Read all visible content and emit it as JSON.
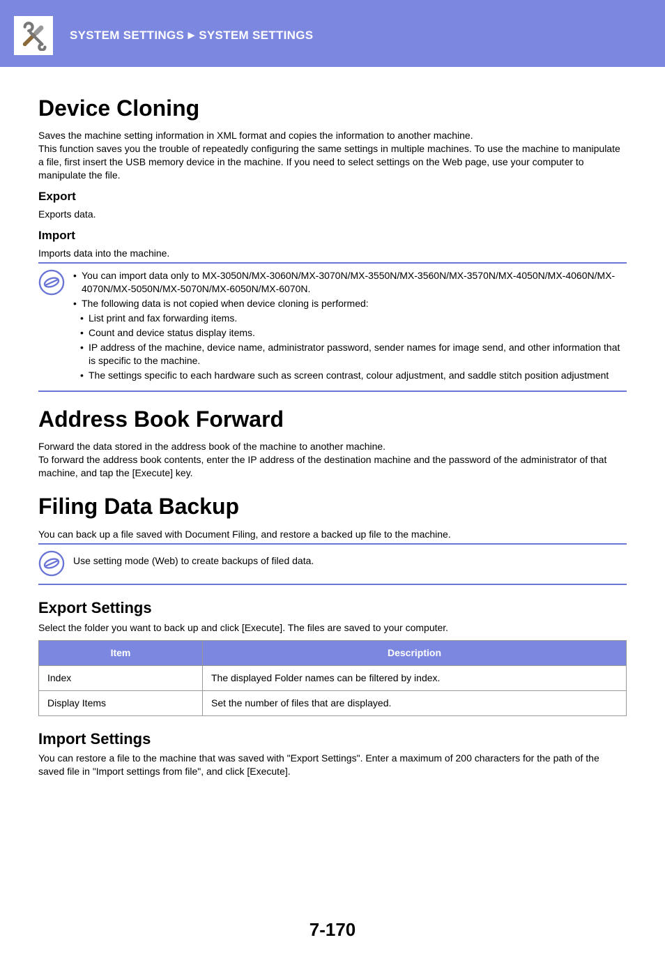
{
  "header": {
    "breadcrumb_a": "SYSTEM SETTINGS",
    "breadcrumb_sep": "►",
    "breadcrumb_b": "SYSTEM SETTINGS"
  },
  "sections": {
    "device_cloning": {
      "title": "Device Cloning",
      "intro": "Saves the machine setting information in XML format and copies the information to another machine.\nThis function saves you the trouble of repeatedly configuring the same settings in multiple machines. To use the machine to manipulate a file, first insert the USB memory device in the machine. If you need to select settings on the Web page, use your computer to manipulate the file.",
      "export_h": "Export",
      "export_p": "Exports data.",
      "import_h": "Import",
      "import_p": "Imports data into the machine.",
      "note_top": [
        "You can import data only to MX-3050N/MX-3060N/MX-3070N/MX-3550N/MX-3560N/MX-3570N/MX-4050N/MX-4060N/MX-4070N/MX-5050N/MX-5070N/MX-6050N/MX-6070N.",
        "The following data is not copied when device cloning is performed:"
      ],
      "note_sub": [
        "List print and fax forwarding items.",
        "Count and device status display items.",
        "IP address of the machine, device name, administrator password, sender names for image send, and other information that is specific to the machine.",
        "The settings specific to each hardware such as screen contrast, colour adjustment, and saddle stitch position adjustment"
      ]
    },
    "address_book": {
      "title": "Address Book Forward",
      "body": "Forward the data stored in the address book of the machine to another machine.\nTo forward the address book contents, enter the IP address of the destination machine and the password of the administrator of that machine, and tap the [Execute] key."
    },
    "filing_backup": {
      "title": "Filing Data Backup",
      "intro": "You can back up a file saved with Document Filing, and restore a backed up file to the machine.",
      "note": "Use setting mode (Web) to create backups of filed data.",
      "export_h": "Export Settings",
      "export_p": "Select the folder you want to back up and click [Execute]. The files are saved to your computer.",
      "table": {
        "head_item": "Item",
        "head_desc": "Description",
        "rows": [
          {
            "item": "Index",
            "desc": "The displayed Folder names can be filtered by index."
          },
          {
            "item": "Display Items",
            "desc": "Set the number of files that are displayed."
          }
        ]
      },
      "import_h": "Import Settings",
      "import_p": "You can restore a file to the machine that was saved with \"Export Settings\". Enter a maximum of 200 characters for the path of the saved file in \"Import settings from file\", and click [Execute]."
    }
  },
  "page_number": "7-170"
}
